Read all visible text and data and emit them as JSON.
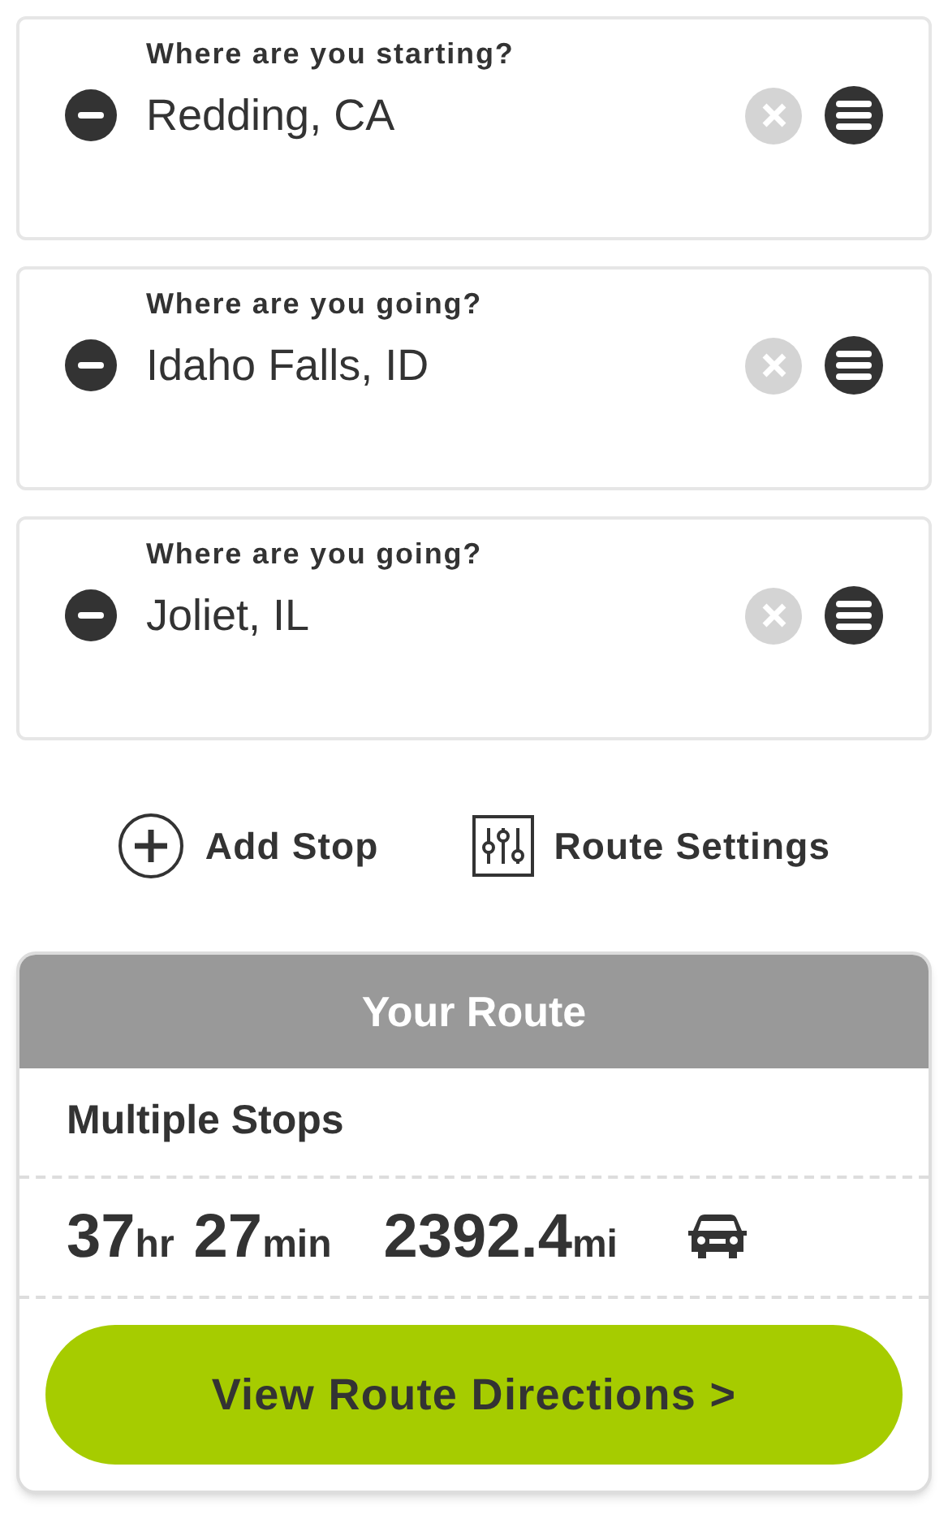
{
  "stops": [
    {
      "label": "Where are you starting?",
      "value": "Redding, CA"
    },
    {
      "label": "Where are you going?",
      "value": "Idaho Falls, ID"
    },
    {
      "label": "Where are you going?",
      "value": "Joliet, IL"
    }
  ],
  "actions": [
    {
      "kind": "add",
      "label": "Add Stop"
    },
    {
      "kind": "settings",
      "label": "Route Settings"
    }
  ],
  "route": {
    "title": "Your Route",
    "subtitle": "Multiple Stops",
    "duration": [
      {
        "value": "37",
        "unit": "hr"
      },
      {
        "value": "27",
        "unit": "min"
      }
    ],
    "distance": {
      "value": "2392.4",
      "unit": "mi"
    },
    "button": "View Route Directions >"
  }
}
